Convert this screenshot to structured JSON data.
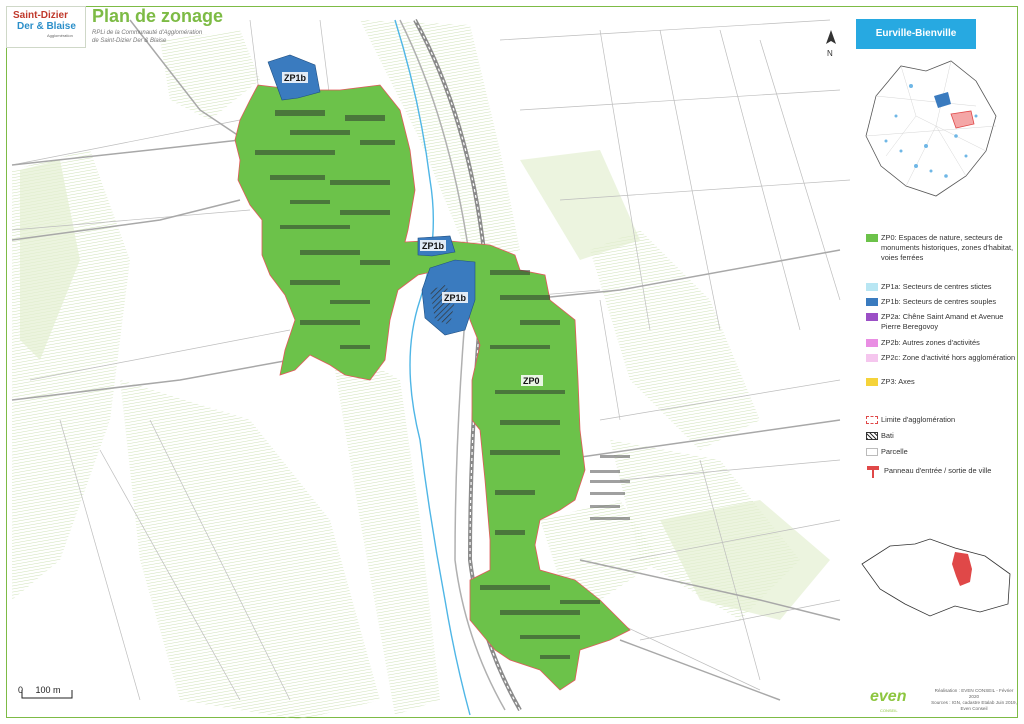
{
  "header": {
    "title": "Plan de zonage",
    "subtitle_line1": "RPLi de la Communauté d'Agglomération",
    "subtitle_line2": "de Saint-Dizier Der & Blaise",
    "logo_line1": "Saint-Dizier",
    "logo_line2": "Der & Blaise",
    "logo_line3": "Agglomération"
  },
  "north_arrow": {
    "label": "N"
  },
  "commune": "Eurville-Bienville",
  "map_labels": {
    "zp1b_north": "ZP1b",
    "zp1b_center": "ZP1b",
    "zp1b_main": "ZP1b",
    "zp0": "ZP0"
  },
  "legend": {
    "zones": [
      {
        "id": "zp0",
        "label": "ZP0: Espaces de nature, secteurs de monuments historiques, zones d'habitat, voies ferrées",
        "color": "#6cc24a"
      },
      {
        "id": "zp1a",
        "label": "ZP1a: Secteurs de centres stictes",
        "color": "#b8e6f3"
      },
      {
        "id": "zp1b",
        "label": "ZP1b: Secteurs de centres souples",
        "color": "#3a7bbf"
      },
      {
        "id": "zp2a",
        "label": "ZP2a: Chêne Saint Amand et Avenue Pierre Beregovoy",
        "color": "#9b4fc6"
      },
      {
        "id": "zp2b",
        "label": "ZP2b: Autres zones d'activités",
        "color": "#e98ee3"
      },
      {
        "id": "zp2c",
        "label": "ZP2c: Zone d'activité hors agglomération",
        "color": "#f5c6ee"
      },
      {
        "id": "zp3",
        "label": "ZP3: Axes",
        "color": "#f5d33a"
      }
    ],
    "other": [
      {
        "id": "limite",
        "label": "Limite d'agglomération"
      },
      {
        "id": "bati",
        "label": "Bati"
      },
      {
        "id": "parcelle",
        "label": "Parcelle"
      },
      {
        "id": "panneau",
        "label": "Panneau d'entrée / sortie de ville"
      }
    ]
  },
  "scale": {
    "label": "0     100 m"
  },
  "credits": {
    "line1": "Réalisation : EVEN CONSEIL - Février 2020",
    "line2": "Sources : IGN, cadastre Etalab Juin 2019,",
    "line3": "Even Conseil",
    "brand": "even",
    "brand_sub": "CONSEIL"
  }
}
